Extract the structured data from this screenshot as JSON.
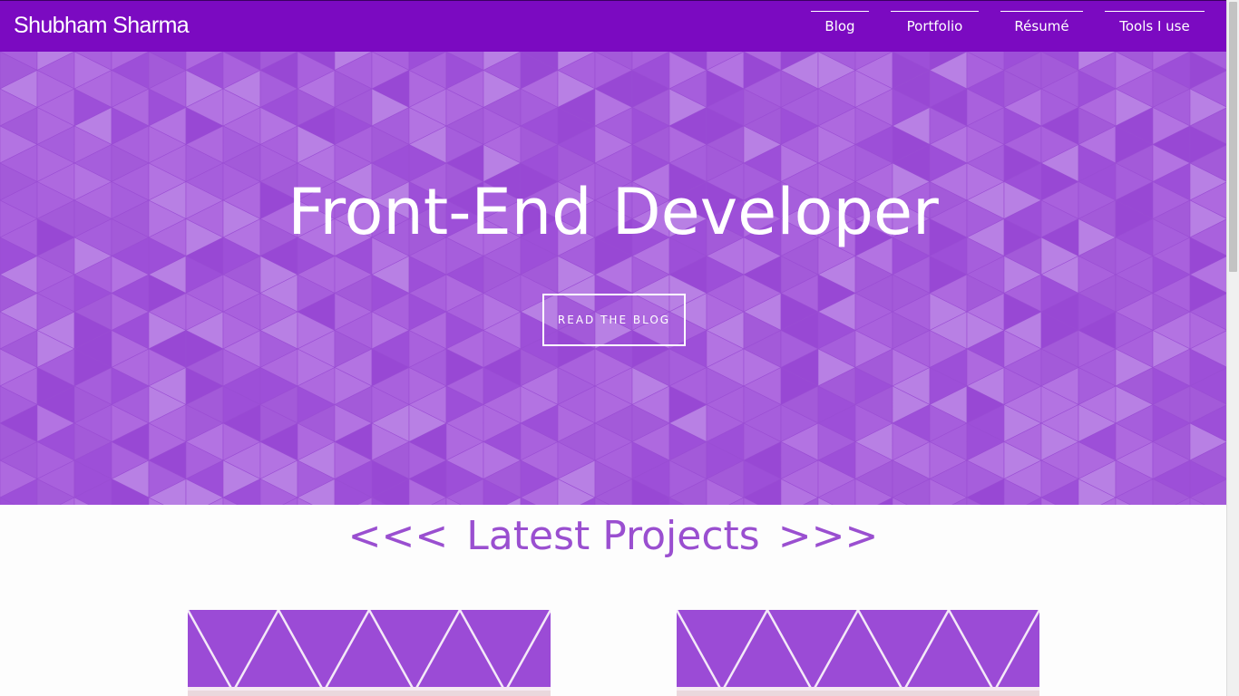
{
  "brand": {
    "name": "Shubham Sharma"
  },
  "nav": {
    "items": [
      {
        "label": "Blog"
      },
      {
        "label": "Portfolio"
      },
      {
        "label": "Résumé"
      },
      {
        "label": "Tools I use"
      }
    ]
  },
  "hero": {
    "title": "Front-End Developer",
    "button_label": "READ THE BLOG"
  },
  "projects": {
    "arrow_left": "<<<",
    "title": "Latest Projects",
    "arrow_right": ">>>"
  },
  "colors": {
    "navbar": "#7b0ac1",
    "hero_base": "#a45bdb",
    "heading": "#9a4fd0",
    "card": "#9b4bd6"
  }
}
